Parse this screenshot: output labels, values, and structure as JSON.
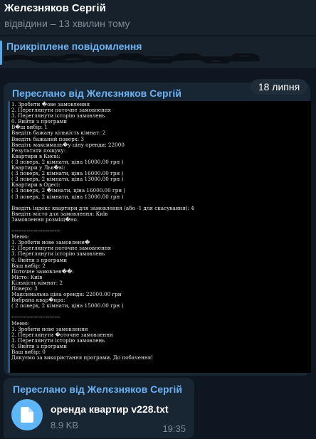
{
  "header": {
    "contact_name": "Желєзняков Сергій",
    "status": "відвідини – 13 хвилин тому"
  },
  "pinned": {
    "title": "Прикріплене повідомлення"
  },
  "date_label": "18 липня",
  "message1": {
    "forwarded_label": "Переслано від Желєзняков Сергій",
    "terminal_lines": [
      "1. Зробити �ове замовлення",
      "2. Переглянути поточне замовлення",
      "3. Переглянути історію замовлень",
      "0. Вийти з програми",
      "В�ш вибір: 1",
      "Введіть бажану кількість кімнат: 2",
      "Введіть бажаний поверх: 3",
      "Введіть максималь�у ціну оренди: 22000",
      "Результати пошуку:",
      "Квартири в Києві:",
      "( 3 поверх, 2 кімнати, ціна 16000.00 грн )",
      "Квартири у Льв�ві:",
      "( 3 поверх, 2 кімнати, ціна 16000.00 грн )",
      "( 3 поверх, 2 кімнати, ціна 13000.00 грн )",
      "Квартири в Одесі:",
      "( 3 поверх, 2 �імнати, ціна 16000.00 грн )",
      "( 3 поверх, 2 кімнати, ціна 13000.00 грн )",
      "",
      "Введіть індекс квартири для замовлення (або -1 для скасування): 4",
      "Введіть місто для замовлення: Київ",
      "Замовлення розміщ�но.",
      "",
      "----------------------------",
      "Меню:",
      "1. Зробити нове замовленн�",
      "2. Переглянути поточне замовлення",
      "3. Переглянути історію замовлень",
      "0. Вийти з програми",
      "Ваш вибір: 2",
      "Поточне замовлен��:",
      "Місто: Київ",
      "Кількість кімнат: 2",
      "Поверх: 3",
      "Максимальна ціна оренди: 22000.00 грн",
      "Вибрана квар�ира:",
      "( 2 поверх, 2 кімнати, ціна 15000.00 грн )",
      "",
      "----------------------------",
      "Меню:",
      "1. Зробити нове замовлення",
      "2. Переглянути �оточне замовлення",
      "3. Переглянути історію замовлень",
      "0. Вийти з програми",
      "Ваш вибір: 0",
      "Дякуємо за використання програми. До побачення!"
    ]
  },
  "message2": {
    "forwarded_label": "Переслано від Желєзняков Сергій",
    "file_name": "оренда квартир v228.txt",
    "file_size": "8.9 KB",
    "time": "19:35"
  },
  "colors": {
    "accent": "#6ab2f2",
    "file_icon": "#5eb5f7",
    "bubble": "#182533",
    "background": "#0e1621"
  }
}
